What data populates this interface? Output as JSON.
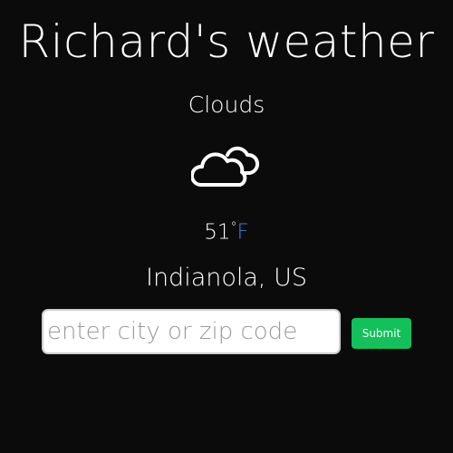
{
  "header": {
    "title": "Richard's weather"
  },
  "weather": {
    "condition": "Clouds",
    "icon": "clouds-icon",
    "temperature": "51",
    "degree_symbol": "°",
    "unit": "F",
    "location": "Indianola, US"
  },
  "search": {
    "placeholder": "enter city or zip code",
    "value": "",
    "submit_label": "Submit"
  },
  "colors": {
    "background": "#0b0b0b",
    "unit_accent": "#3d7fd6",
    "submit_button": "#12c15a"
  }
}
